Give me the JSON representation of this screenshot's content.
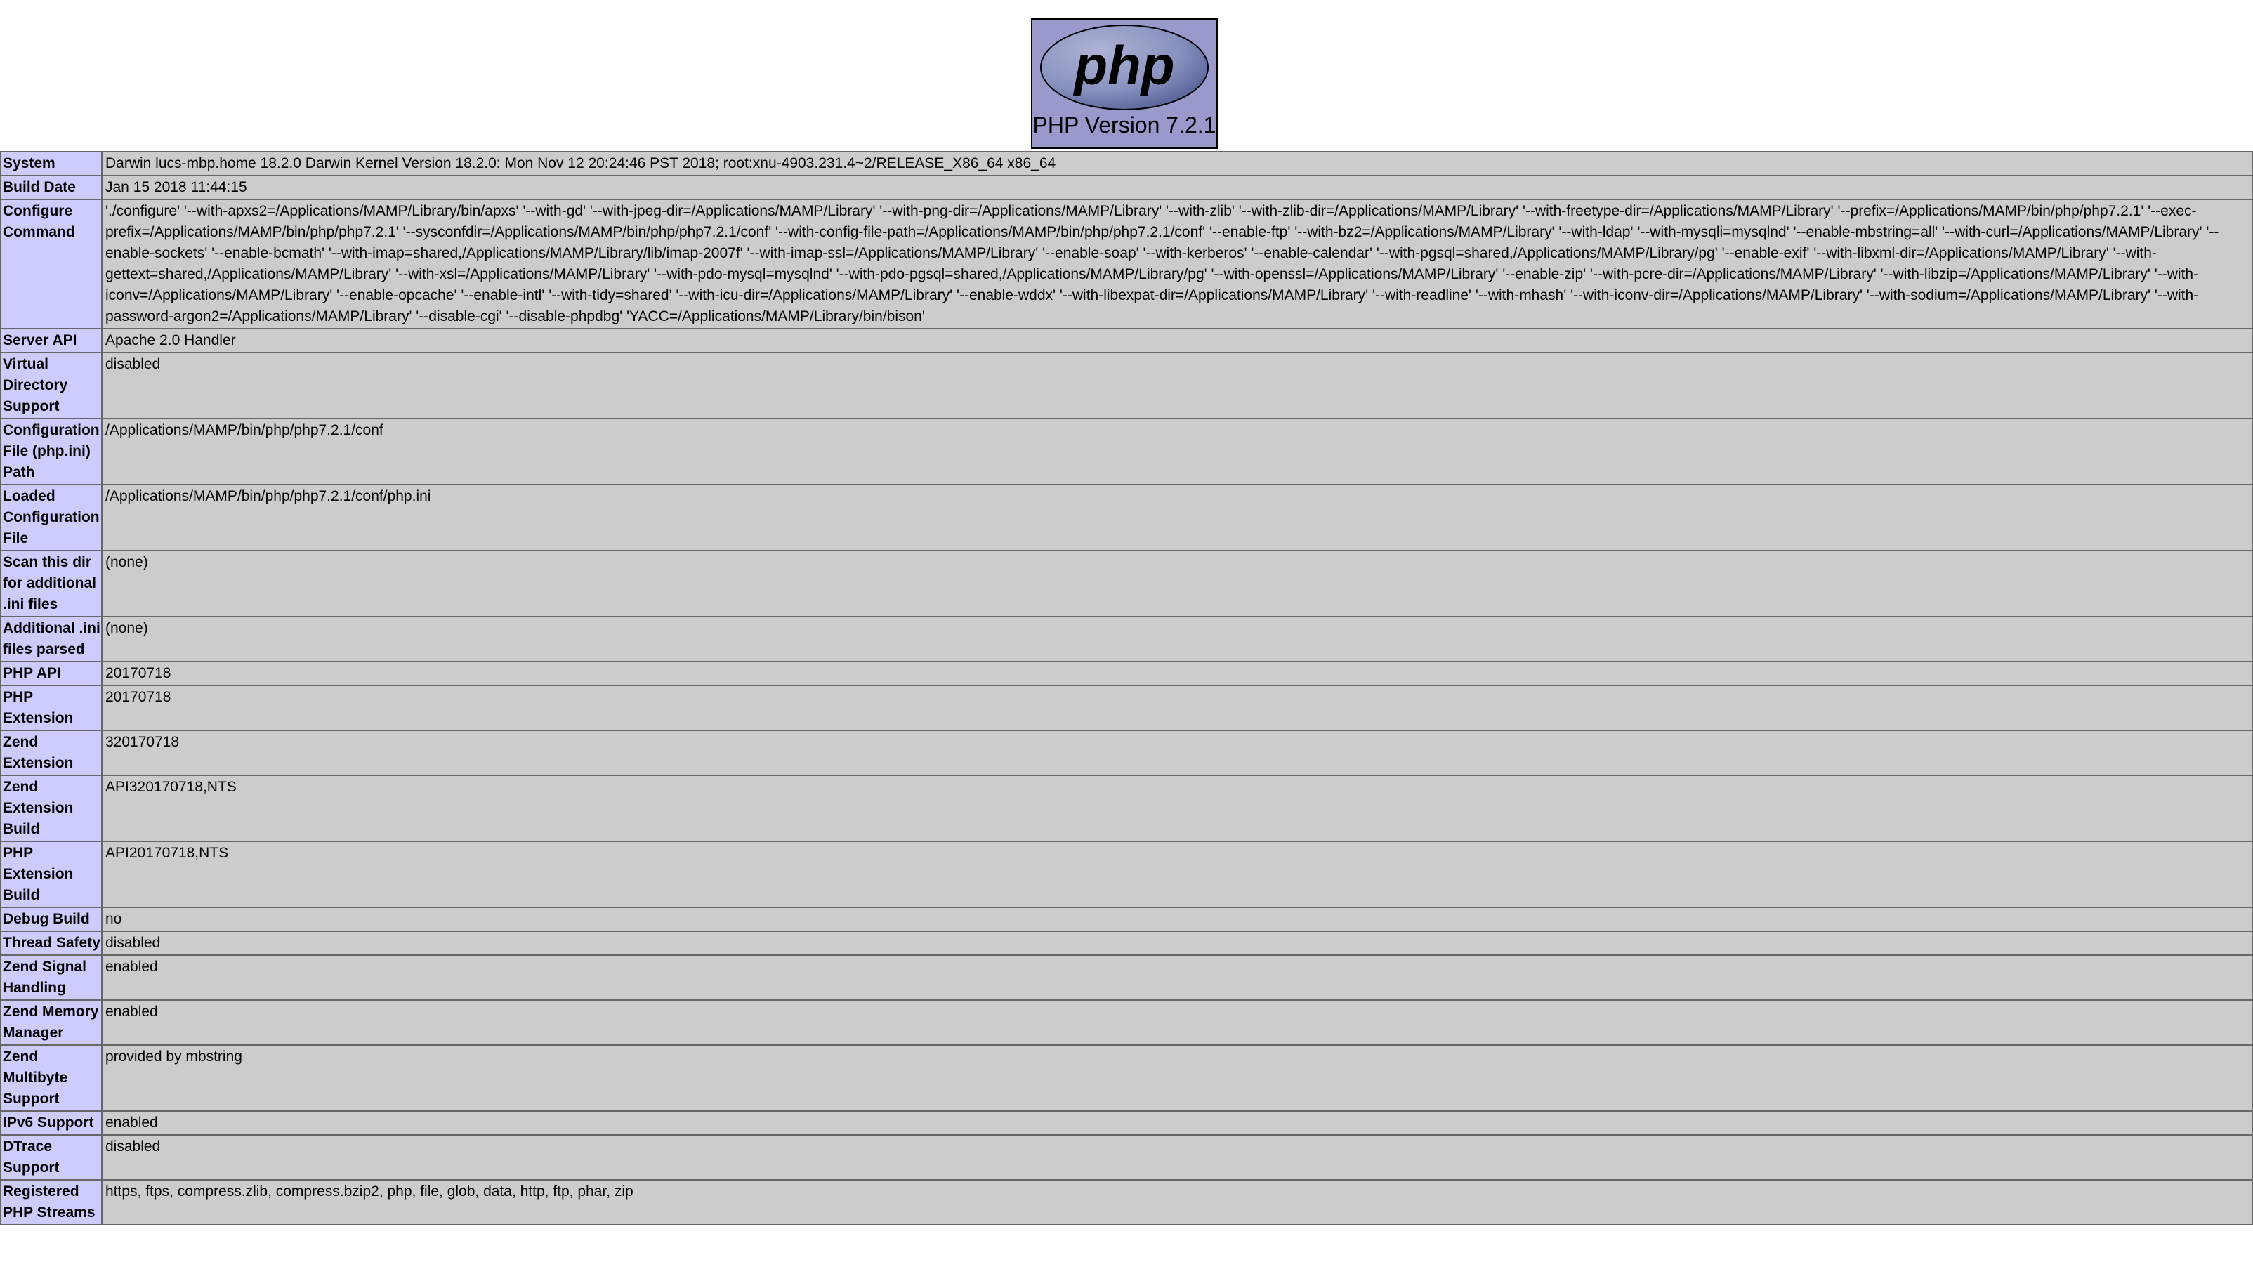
{
  "header": {
    "logo_text": "php",
    "version_label": "PHP Version 7.2.1"
  },
  "colors": {
    "header_bg": "#9999cc",
    "label_bg": "#ccccff",
    "value_bg": "#cccccc",
    "border": "#666666"
  },
  "rows": [
    {
      "label": "System",
      "value": "Darwin lucs-mbp.home 18.2.0 Darwin Kernel Version 18.2.0: Mon Nov 12 20:24:46 PST 2018; root:xnu-4903.231.4~2/RELEASE_X86_64 x86_64"
    },
    {
      "label": "Build Date",
      "value": "Jan 15 2018 11:44:15"
    },
    {
      "label": "Configure Command",
      "value": "'./configure' '--with-apxs2=/Applications/MAMP/Library/bin/apxs' '--with-gd' '--with-jpeg-dir=/Applications/MAMP/Library' '--with-png-dir=/Applications/MAMP/Library' '--with-zlib' '--with-zlib-dir=/Applications/MAMP/Library' '--with-freetype-dir=/Applications/MAMP/Library' '--prefix=/Applications/MAMP/bin/php/php7.2.1' '--exec-prefix=/Applications/MAMP/bin/php/php7.2.1' '--sysconfdir=/Applications/MAMP/bin/php/php7.2.1/conf' '--with-config-file-path=/Applications/MAMP/bin/php/php7.2.1/conf' '--enable-ftp' '--with-bz2=/Applications/MAMP/Library' '--with-ldap' '--with-mysqli=mysqlnd' '--enable-mbstring=all' '--with-curl=/Applications/MAMP/Library' '--enable-sockets' '--enable-bcmath' '--with-imap=shared,/Applications/MAMP/Library/lib/imap-2007f' '--with-imap-ssl=/Applications/MAMP/Library' '--enable-soap' '--with-kerberos' '--enable-calendar' '--with-pgsql=shared,/Applications/MAMP/Library/pg' '--enable-exif' '--with-libxml-dir=/Applications/MAMP/Library' '--with-gettext=shared,/Applications/MAMP/Library' '--with-xsl=/Applications/MAMP/Library' '--with-pdo-mysql=mysqlnd' '--with-pdo-pgsql=shared,/Applications/MAMP/Library/pg' '--with-openssl=/Applications/MAMP/Library' '--enable-zip' '--with-pcre-dir=/Applications/MAMP/Library' '--with-libzip=/Applications/MAMP/Library' '--with-iconv=/Applications/MAMP/Library' '--enable-opcache' '--enable-intl' '--with-tidy=shared' '--with-icu-dir=/Applications/MAMP/Library' '--enable-wddx' '--with-libexpat-dir=/Applications/MAMP/Library' '--with-readline' '--with-mhash' '--with-iconv-dir=/Applications/MAMP/Library' '--with-sodium=/Applications/MAMP/Library' '--with-password-argon2=/Applications/MAMP/Library' '--disable-cgi' '--disable-phpdbg' 'YACC=/Applications/MAMP/Library/bin/bison'"
    },
    {
      "label": "Server API",
      "value": "Apache 2.0 Handler"
    },
    {
      "label": "Virtual Directory Support",
      "value": "disabled"
    },
    {
      "label": "Configuration File (php.ini) Path",
      "value": "/Applications/MAMP/bin/php/php7.2.1/conf"
    },
    {
      "label": "Loaded Configuration File",
      "value": "/Applications/MAMP/bin/php/php7.2.1/conf/php.ini"
    },
    {
      "label": "Scan this dir for additional .ini files",
      "value": "(none)"
    },
    {
      "label": "Additional .ini files parsed",
      "value": "(none)"
    },
    {
      "label": "PHP API",
      "value": "20170718"
    },
    {
      "label": "PHP Extension",
      "value": "20170718"
    },
    {
      "label": "Zend Extension",
      "value": "320170718"
    },
    {
      "label": "Zend Extension Build",
      "value": "API320170718,NTS"
    },
    {
      "label": "PHP Extension Build",
      "value": "API20170718,NTS"
    },
    {
      "label": "Debug Build",
      "value": "no"
    },
    {
      "label": "Thread Safety",
      "value": "disabled"
    },
    {
      "label": "Zend Signal Handling",
      "value": "enabled"
    },
    {
      "label": "Zend Memory Manager",
      "value": "enabled"
    },
    {
      "label": "Zend Multibyte Support",
      "value": "provided by mbstring"
    },
    {
      "label": "IPv6 Support",
      "value": "enabled"
    },
    {
      "label": "DTrace Support",
      "value": "disabled"
    },
    {
      "label": "Registered PHP Streams",
      "value": "https, ftps, compress.zlib, compress.bzip2, php, file, glob, data, http, ftp, phar, zip"
    }
  ]
}
